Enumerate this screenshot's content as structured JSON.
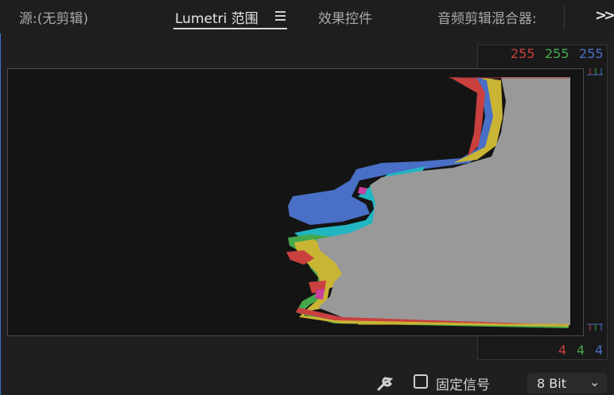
{
  "tabs": {
    "source": "源:(无剪辑)",
    "lumetri_scopes": "Lumetri 范围",
    "effect_controls": "效果控件",
    "audio_mixer": "音频剪辑混合器:"
  },
  "icons": {
    "panel_menu": "hamburger-menu-icon",
    "overflow": "double-chevron-right-icon",
    "settings": "wrench-icon",
    "dropdown": "chevron-down-icon"
  },
  "scale": {
    "top": {
      "r": "255",
      "g": "255",
      "b": "255"
    },
    "bottom": {
      "r": "4",
      "g": "4",
      "b": "4"
    }
  },
  "footer": {
    "clamp_signal_label": "固定信号",
    "clamp_signal_checked": false,
    "bit_depth_value": "8 Bit"
  },
  "colors": {
    "red": "#c9403f",
    "green": "#45a84c",
    "blue": "#4a6fc6",
    "yellow": "#c9b434",
    "cyan": "#22b5c2",
    "magenta": "#c840a0",
    "luma": "#999999",
    "accent_border": "#3b6fd6"
  }
}
